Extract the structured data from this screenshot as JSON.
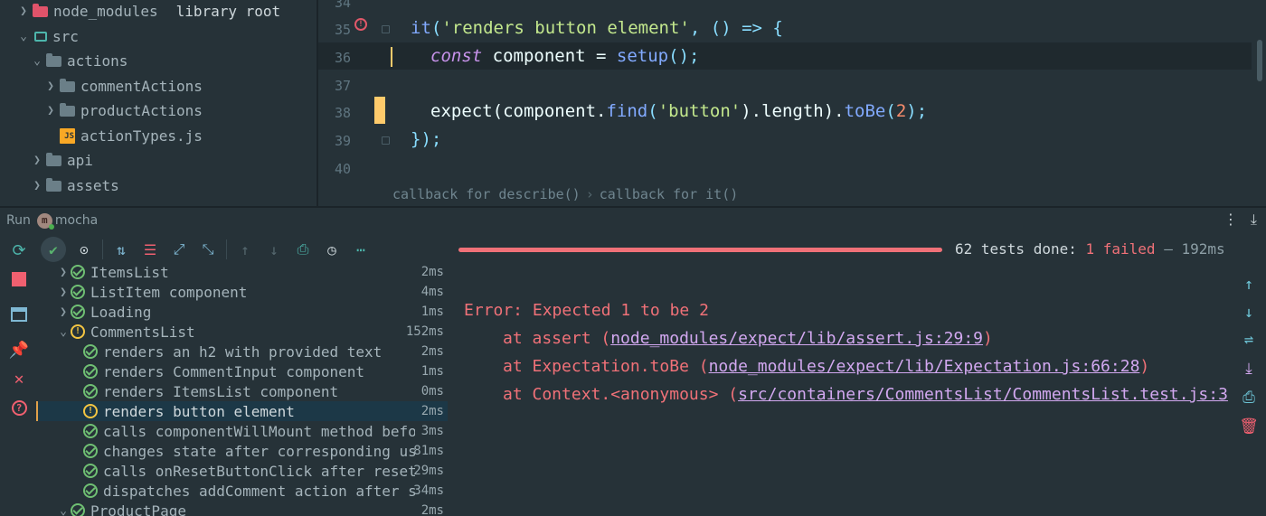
{
  "project_tree": {
    "items": [
      {
        "label": "node_modules",
        "extra": "library root",
        "icon": "folder-red-icon",
        "expanded": false
      },
      {
        "label": "src",
        "icon": "folder-source-icon",
        "expanded": true
      },
      {
        "label": "actions",
        "icon": "folder-icon",
        "expanded": true
      },
      {
        "label": "commentActions",
        "icon": "folder-icon",
        "expanded": false
      },
      {
        "label": "productActions",
        "icon": "folder-icon",
        "expanded": false
      },
      {
        "label": "actionTypes.js",
        "icon": "js-file-icon"
      },
      {
        "label": "api",
        "icon": "folder-icon",
        "expanded": false
      },
      {
        "label": "assets",
        "icon": "folder-icon",
        "expanded": false
      }
    ]
  },
  "editor": {
    "line_numbers": [
      "34",
      "35",
      "36",
      "37",
      "38",
      "39",
      "40"
    ],
    "lines": {
      "l35": {
        "it": "it",
        "p1": "(",
        "desc": "'renders button element'",
        "p2": ", () => {"
      },
      "l36": {
        "kw": "const",
        "var": " component = ",
        "fn": "setup",
        "p": "();"
      },
      "l38": {
        "a": "expect",
        "b": "(component.",
        "c": "find",
        "d": "(",
        "e": "'button'",
        "f": ").length).",
        "g": "toBe",
        "h": "(",
        "i": "2",
        "j": ");"
      },
      "l39": {
        "a": "});"
      }
    },
    "breadcrumb": [
      "callback for describe()",
      "callback for it()"
    ],
    "breadcrumb_separator": "›"
  },
  "run_panel": {
    "label": "Run",
    "config_name": "mocha",
    "config_icon_letter": "m",
    "summary": {
      "done": "62 tests done: ",
      "failed": "1 failed",
      "time": " – 192ms"
    },
    "progress": {
      "passed": 61,
      "failed": 1,
      "total": 62
    },
    "tests": [
      {
        "name": "ItemsList",
        "time": "2ms",
        "status": "passed",
        "level": 0,
        "expandable": true
      },
      {
        "name": "ListItem component",
        "time": "4ms",
        "status": "passed",
        "level": 0,
        "expandable": true
      },
      {
        "name": "Loading",
        "time": "1ms",
        "status": "passed",
        "level": 0,
        "expandable": true
      },
      {
        "name": "CommentsList",
        "time": "152ms",
        "status": "failed",
        "level": 0,
        "expandable": true,
        "expanded": true
      },
      {
        "name": "renders an h2 with provided text",
        "time": "2ms",
        "status": "passed",
        "level": 1
      },
      {
        "name": "renders CommentInput component",
        "time": "1ms",
        "status": "passed",
        "level": 1
      },
      {
        "name": "renders ItemsList component",
        "time": "0ms",
        "status": "passed",
        "level": 1
      },
      {
        "name": "renders button element",
        "time": "2ms",
        "status": "failed",
        "level": 1,
        "selected": true
      },
      {
        "name": "calls componentWillMount method befor",
        "time": "3ms",
        "status": "passed",
        "level": 1
      },
      {
        "name": "changes state after corresponding us",
        "time": "81ms",
        "status": "passed",
        "level": 1
      },
      {
        "name": "calls onResetButtonClick after reset",
        "time": "29ms",
        "status": "passed",
        "level": 1
      },
      {
        "name": "dispatches addComment action after s",
        "time": "34ms",
        "status": "passed",
        "level": 1
      },
      {
        "name": "ProductPage",
        "time": "2ms",
        "status": "passed",
        "level": 0,
        "expandable": true,
        "expanded": true
      }
    ],
    "console": {
      "error": "Error: Expected 1 to be 2",
      "stack": [
        {
          "prefix": "at assert (",
          "link": "node_modules/expect/lib/assert.js:29:9",
          "suffix": ")"
        },
        {
          "prefix": "at Expectation.toBe (",
          "link": "node_modules/expect/lib/Expectation.js:66:28",
          "suffix": ")"
        },
        {
          "prefix": "at Context.<anonymous> (",
          "link": "src/containers/CommentsList/CommentsList.test.js:3",
          "suffix": ""
        }
      ]
    }
  },
  "colors": {
    "background": "#263238",
    "passed": "#6fbf73",
    "failed": "#f07178",
    "warning": "#f4c542",
    "accent": "#82aaff"
  }
}
